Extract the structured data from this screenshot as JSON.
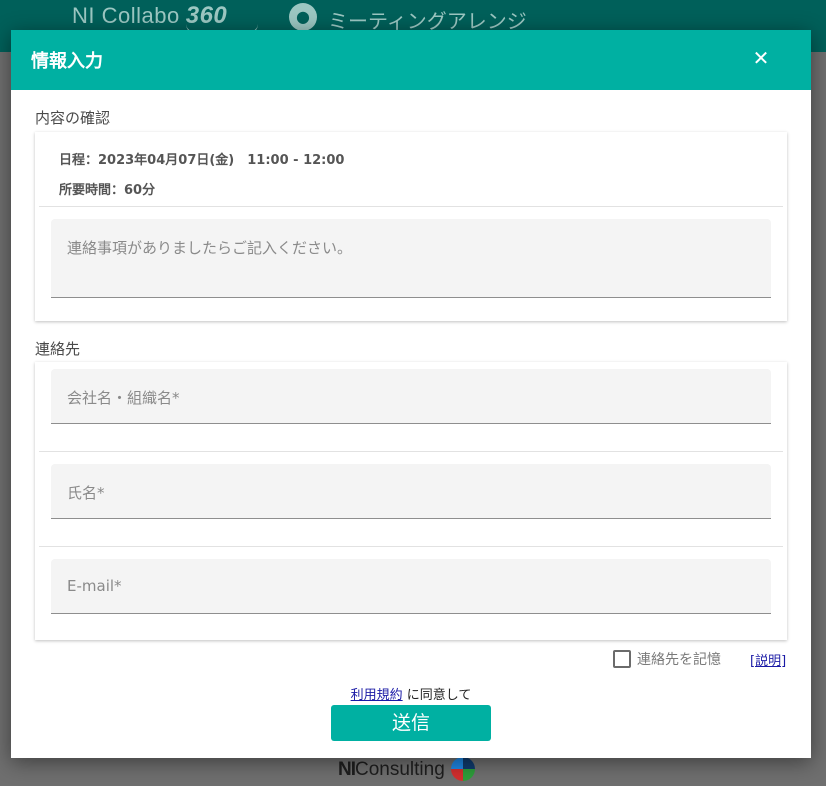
{
  "app": {
    "brand_text": "NI Collabo",
    "brand_number": "360",
    "app_name": "ミーティングアレンジ",
    "footer_brand_bold": "NI",
    "footer_brand_rest": "Consulting"
  },
  "dialog": {
    "title": "情報入力",
    "close_icon": "close-icon",
    "confirm_section": {
      "label": "内容の確認",
      "schedule": "日程：2023年04月07日(金)　11:00 - 12:00",
      "duration": "所要時間：60分",
      "message_placeholder": "連絡事項がありましたらご記入ください。"
    },
    "contact_section": {
      "label": "連絡先",
      "fields": [
        {
          "label": "会社名・組織名*"
        },
        {
          "label": "氏名*"
        },
        {
          "label": "E-mail*"
        }
      ]
    },
    "remember_label": "連絡先を記憶",
    "help_link": "[説明]",
    "terms_link": "利用規約",
    "terms_suffix": " に同意して",
    "submit_label": "送信"
  },
  "colors": {
    "accent": "#00b0a2",
    "app_header": "#00605a",
    "link": "#1a1aa6"
  }
}
